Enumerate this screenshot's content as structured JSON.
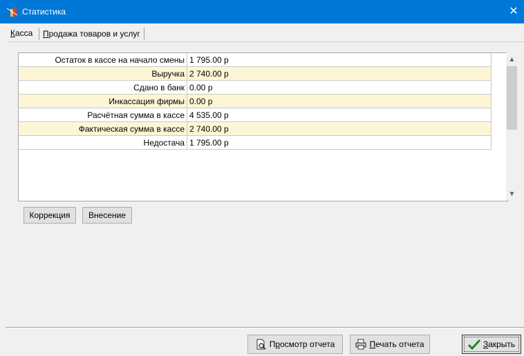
{
  "window": {
    "title": "Статистика",
    "close_glyph": "✕"
  },
  "tabs": [
    {
      "label_u": "К",
      "label_rest": "асса",
      "active": true
    },
    {
      "label_u": "П",
      "label_rest": "родажа товаров и услуг",
      "active": false
    }
  ],
  "stats_table": {
    "rows": [
      {
        "label": "Остаток в кассе на начало смены",
        "value": "1 795.00 р"
      },
      {
        "label": "Выручка",
        "value": "2 740.00 р"
      },
      {
        "label": "Сдано в банк",
        "value": "0.00 р"
      },
      {
        "label": "Инкассация фирмы",
        "value": "0.00 р"
      },
      {
        "label": "Расчётная сумма в кассе",
        "value": "4 535.00 р"
      },
      {
        "label": "Фактическая сумма в кассе",
        "value": "2 740.00 р"
      },
      {
        "label": "Недостача",
        "value": "1 795.00 р"
      }
    ]
  },
  "buttons": {
    "correction": "Коррекция",
    "deposit": "Внесение",
    "preview_pre": "П",
    "preview_u": "р",
    "preview_post": "осмотр отчета",
    "print_u": "П",
    "print_post": "ечать отчета",
    "close_u": "З",
    "close_post": "акрыть"
  },
  "colors": {
    "titlebar": "#0078d7",
    "row_highlight": "#fdf6d6",
    "check_green": "#1a8a1a"
  }
}
